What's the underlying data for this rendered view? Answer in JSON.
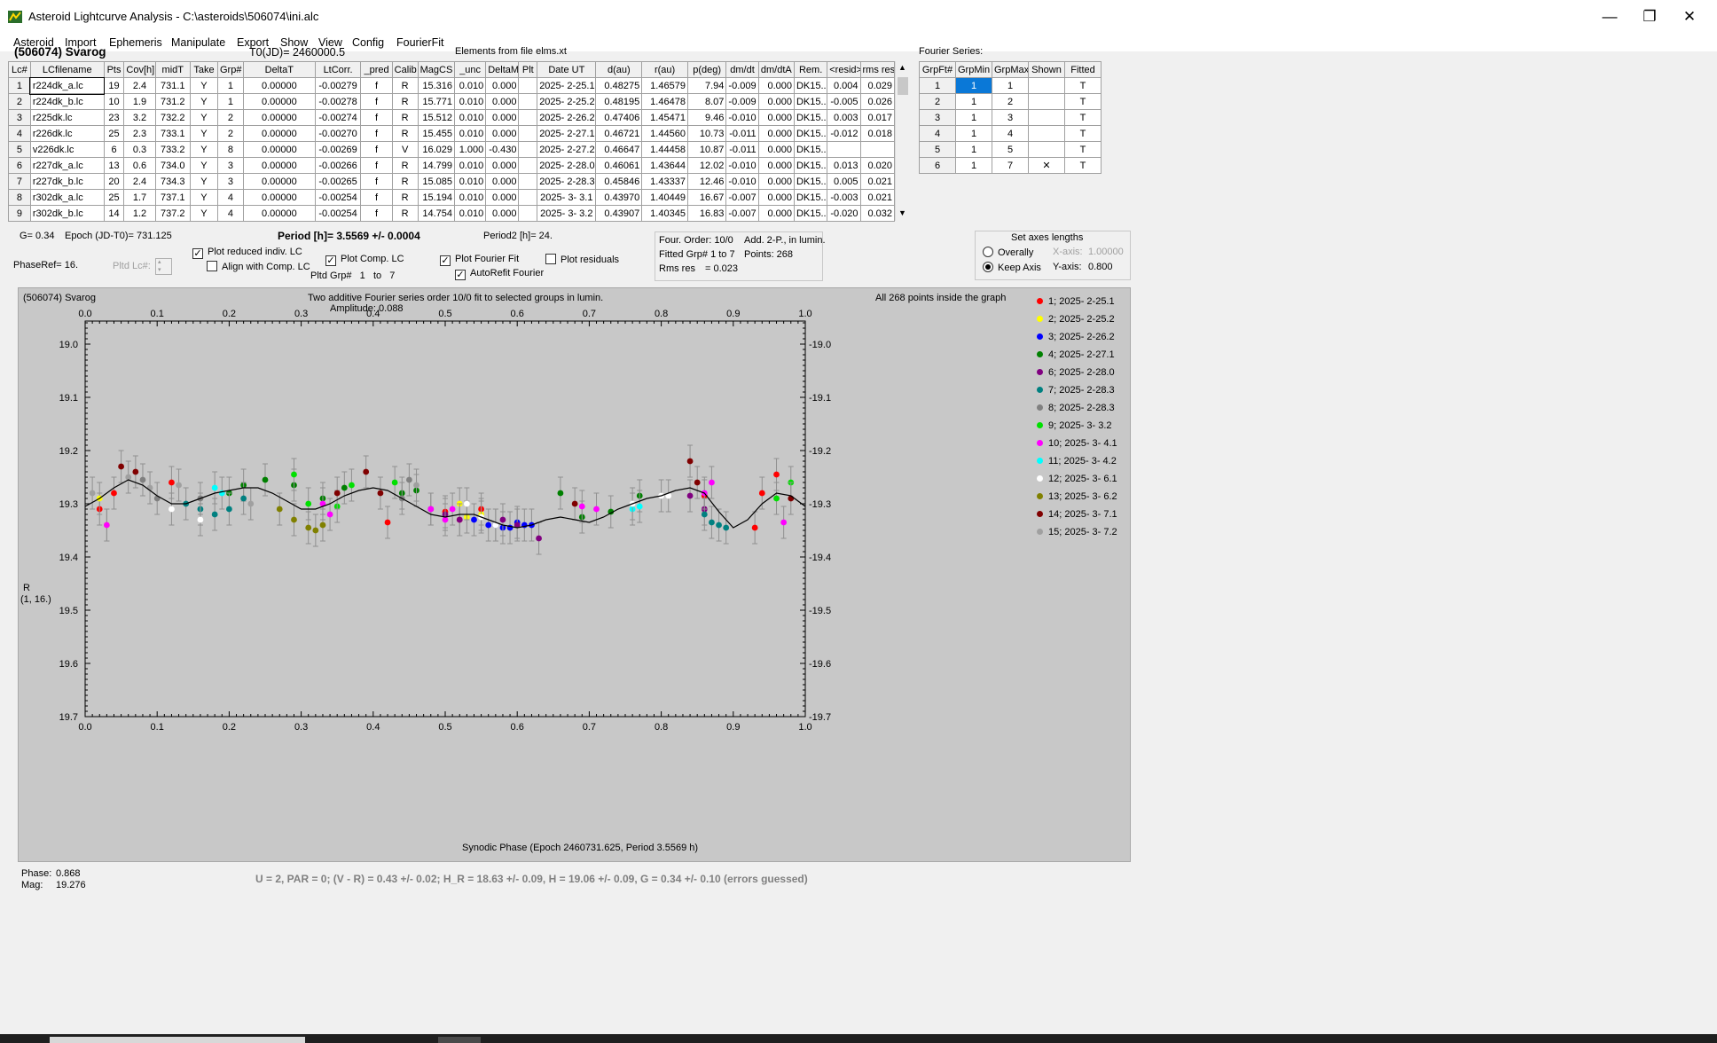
{
  "window": {
    "title": "Asteroid Lightcurve Analysis - C:\\asteroids\\506074\\ini.alc",
    "minimize": "—",
    "maximize": "❐",
    "close": "✕"
  },
  "menu": [
    "Asteroid",
    "Import",
    "Ephemeris",
    "Manipulate",
    "Export",
    "Show",
    "View",
    "Config",
    "FourierFit"
  ],
  "header": {
    "object": "(506074) Svarog",
    "t0": "T0(JD)= 2460000.5",
    "elements": "Elements from file elms.xt",
    "fourier_series": "Fourier Series:"
  },
  "lc_table": {
    "columns": [
      "Lc#",
      "LCfilename",
      "Pts",
      "Cov[h]",
      "midT",
      "Take",
      "Grp#",
      "DeltaT",
      "LtCorr.",
      "_pred",
      "Calib",
      "MagCS",
      "_unc",
      "DeltaM",
      "Plt",
      "Date UT",
      "d(au)",
      "r(au)",
      "p(deg)",
      "dm/dt",
      "dm/dtA",
      "Rem.",
      "<resid>",
      "rms res"
    ],
    "rows": [
      [
        "1",
        "r224dk_a.lc",
        "19",
        "2.4",
        "731.1",
        "Y",
        "1",
        "0.00000",
        "-0.00279",
        "f",
        "R",
        "15.316",
        "0.010",
        "0.000",
        "",
        "2025- 2-25.1",
        "0.48275",
        "1.46579",
        "7.94",
        "-0.009",
        "0.000",
        "DK15..",
        "0.004",
        "0.029"
      ],
      [
        "2",
        "r224dk_b.lc",
        "10",
        "1.9",
        "731.2",
        "Y",
        "1",
        "0.00000",
        "-0.00278",
        "f",
        "R",
        "15.771",
        "0.010",
        "0.000",
        "",
        "2025- 2-25.2",
        "0.48195",
        "1.46478",
        "8.07",
        "-0.009",
        "0.000",
        "DK15..",
        "-0.005",
        "0.026"
      ],
      [
        "3",
        "r225dk.lc",
        "23",
        "3.2",
        "732.2",
        "Y",
        "2",
        "0.00000",
        "-0.00274",
        "f",
        "R",
        "15.512",
        "0.010",
        "0.000",
        "",
        "2025- 2-26.2",
        "0.47406",
        "1.45471",
        "9.46",
        "-0.010",
        "0.000",
        "DK15..",
        "0.003",
        "0.017"
      ],
      [
        "4",
        "r226dk.lc",
        "25",
        "2.3",
        "733.1",
        "Y",
        "2",
        "0.00000",
        "-0.00270",
        "f",
        "R",
        "15.455",
        "0.010",
        "0.000",
        "",
        "2025- 2-27.1",
        "0.46721",
        "1.44560",
        "10.73",
        "-0.011",
        "0.000",
        "DK15..",
        "-0.012",
        "0.018"
      ],
      [
        "5",
        "v226dk.lc",
        "6",
        "0.3",
        "733.2",
        "Y",
        "8",
        "0.00000",
        "-0.00269",
        "f",
        "V",
        "16.029",
        "1.000",
        "-0.430",
        "",
        "2025- 2-27.2",
        "0.46647",
        "1.44458",
        "10.87",
        "-0.011",
        "0.000",
        "DK15..",
        "",
        ""
      ],
      [
        "6",
        "r227dk_a.lc",
        "13",
        "0.6",
        "734.0",
        "Y",
        "3",
        "0.00000",
        "-0.00266",
        "f",
        "R",
        "14.799",
        "0.010",
        "0.000",
        "",
        "2025- 2-28.0",
        "0.46061",
        "1.43644",
        "12.02",
        "-0.010",
        "0.000",
        "DK15..",
        "0.013",
        "0.020"
      ],
      [
        "7",
        "r227dk_b.lc",
        "20",
        "2.4",
        "734.3",
        "Y",
        "3",
        "0.00000",
        "-0.00265",
        "f",
        "R",
        "15.085",
        "0.010",
        "0.000",
        "",
        "2025- 2-28.3",
        "0.45846",
        "1.43337",
        "12.46",
        "-0.010",
        "0.000",
        "DK15..",
        "0.005",
        "0.021"
      ],
      [
        "8",
        "r302dk_a.lc",
        "25",
        "1.7",
        "737.1",
        "Y",
        "4",
        "0.00000",
        "-0.00254",
        "f",
        "R",
        "15.194",
        "0.010",
        "0.000",
        "",
        "2025- 3- 3.1",
        "0.43970",
        "1.40449",
        "16.67",
        "-0.007",
        "0.000",
        "DK15..",
        "-0.003",
        "0.021"
      ],
      [
        "9",
        "r302dk_b.lc",
        "14",
        "1.2",
        "737.2",
        "Y",
        "4",
        "0.00000",
        "-0.00254",
        "f",
        "R",
        "14.754",
        "0.010",
        "0.000",
        "",
        "2025- 3- 3.2",
        "0.43907",
        "1.40345",
        "16.83",
        "-0.007",
        "0.000",
        "DK15..",
        "-0.020",
        "0.032"
      ]
    ]
  },
  "fourier_table": {
    "columns": [
      "GrpFt#",
      "GrpMin",
      "GrpMax",
      "Shown",
      "Fitted"
    ],
    "rows": [
      [
        "1",
        "1",
        "1",
        "",
        "T"
      ],
      [
        "2",
        "1",
        "2",
        "",
        "T"
      ],
      [
        "3",
        "1",
        "3",
        "",
        "T"
      ],
      [
        "4",
        "1",
        "4",
        "",
        "T"
      ],
      [
        "5",
        "1",
        "5",
        "",
        "T"
      ],
      [
        "6",
        "1",
        "7",
        "✕",
        "T"
      ]
    ]
  },
  "controls": {
    "g": "G= 0.34",
    "epoch": "Epoch (JD-T0)= 731.125",
    "period": "Period [h]= 3.5569 +/- 0.0004",
    "period2": "Period2 [h]= 24.",
    "phase_ref": "PhaseRef= 16.",
    "pltd_lc": "Pltd Lc#:",
    "plot_reduced": "Plot reduced indiv. LC",
    "align_comp": "Align with Comp. LC",
    "plot_comp": "Plot Comp. LC",
    "pltd_grp": "Pltd Grp#",
    "pltd_grp_from": "1",
    "pltd_grp_to_label": "to",
    "pltd_grp_to": "7",
    "plot_fourier": "Plot Fourier Fit",
    "autorefit": "AutoRefit Fourier",
    "plot_residuals": "Plot residuals"
  },
  "fit_info": {
    "order": "Four. Order: 10/0",
    "add": "Add. 2-P., in lumin.",
    "fitted": "Fitted Grp# 1 to 7",
    "points": "Points: 268",
    "rms_label": "Rms res",
    "rms_value": "= 0.023"
  },
  "axes_box": {
    "title": "Set axes lengths",
    "overally": "Overally",
    "keep_axis": "Keep Axis",
    "x_axis_label": "X-axis:",
    "x_axis_value": "1.00000",
    "y_axis_label": "Y-axis:",
    "y_axis_value": "0.800"
  },
  "chart_data": {
    "type": "scatter",
    "title": "Two additive Fourier series order 10/0 fit to selected groups in lumin.",
    "subtitle": "Amplitude: 0.088",
    "object_label": "(506074) Svarog",
    "note": "All 268 points inside the graph",
    "xlabel": "Synodic Phase (Epoch 2460731.625, Period 3.5569 h)",
    "ylabel": "R",
    "ylabel2": "(1, 16.)",
    "xlim": [
      0.0,
      1.0
    ],
    "ylim": [
      19.7,
      18.9
    ],
    "x_ticks": [
      "0.0",
      "0.1",
      "0.2",
      "0.3",
      "0.4",
      "0.5",
      "0.6",
      "0.7",
      "0.8",
      "0.9",
      "1.0"
    ],
    "y_ticks": [
      "19.0",
      "19.1",
      "19.2",
      "19.3",
      "19.4",
      "19.5",
      "19.6",
      "19.7"
    ],
    "fit_curve": {
      "x": [
        0.0,
        0.02,
        0.04,
        0.06,
        0.08,
        0.1,
        0.12,
        0.14,
        0.16,
        0.18,
        0.2,
        0.22,
        0.24,
        0.26,
        0.28,
        0.3,
        0.32,
        0.34,
        0.36,
        0.38,
        0.4,
        0.42,
        0.44,
        0.46,
        0.48,
        0.5,
        0.52,
        0.54,
        0.56,
        0.58,
        0.6,
        0.62,
        0.64,
        0.66,
        0.68,
        0.7,
        0.72,
        0.74,
        0.76,
        0.78,
        0.8,
        0.82,
        0.84,
        0.86,
        0.88,
        0.9,
        0.92,
        0.94,
        0.96,
        0.98,
        1.0
      ],
      "y": [
        19.305,
        19.29,
        19.27,
        19.255,
        19.265,
        19.285,
        19.3,
        19.3,
        19.29,
        19.28,
        19.275,
        19.27,
        19.27,
        19.28,
        19.295,
        19.31,
        19.31,
        19.3,
        19.285,
        19.275,
        19.27,
        19.275,
        19.29,
        19.305,
        19.32,
        19.325,
        19.32,
        19.32,
        19.33,
        19.34,
        19.345,
        19.34,
        19.33,
        19.325,
        19.33,
        19.335,
        19.325,
        19.31,
        19.3,
        19.29,
        19.285,
        19.275,
        19.27,
        19.28,
        19.315,
        19.345,
        19.33,
        19.3,
        19.28,
        19.285,
        19.305
      ]
    },
    "series": [
      {
        "name": "1; 2025- 2-25.1",
        "color": "#ff0000",
        "x": [
          0.02,
          0.04,
          0.12,
          0.42,
          0.5,
          0.52,
          0.55,
          0.86,
          0.93,
          0.94,
          0.96
        ],
        "y": [
          19.31,
          19.28,
          19.26,
          19.335,
          19.315,
          19.33,
          19.31,
          19.285,
          19.345,
          19.28,
          19.245
        ]
      },
      {
        "name": "2; 2025- 2-25.2",
        "color": "#ffff00",
        "x": [
          0.02,
          0.03,
          0.52,
          0.53,
          0.55
        ],
        "y": [
          19.29,
          19.34,
          19.3,
          19.325,
          19.32
        ]
      },
      {
        "name": "3; 2025- 2-26.2",
        "color": "#0000ff",
        "x": [
          0.54,
          0.56,
          0.57,
          0.58,
          0.59,
          0.6,
          0.61,
          0.62
        ],
        "y": [
          19.33,
          19.34,
          19.34,
          19.345,
          19.345,
          19.335,
          19.34,
          19.34
        ]
      },
      {
        "name": "4; 2025- 2-27.1",
        "color": "#008000",
        "x": [
          0.2,
          0.22,
          0.25,
          0.29,
          0.33,
          0.36,
          0.44,
          0.46,
          0.66,
          0.69,
          0.73,
          0.77
        ],
        "y": [
          19.28,
          19.265,
          19.255,
          19.265,
          19.29,
          19.27,
          19.28,
          19.275,
          19.28,
          19.325,
          19.315,
          19.285
        ]
      },
      {
        "name": "6; 2025- 2-28.0",
        "color": "#800080",
        "x": [
          0.48,
          0.5,
          0.52,
          0.58,
          0.6,
          0.63,
          0.84,
          0.86
        ],
        "y": [
          19.31,
          19.32,
          19.33,
          19.33,
          19.34,
          19.365,
          19.285,
          19.31
        ]
      },
      {
        "name": "7; 2025- 2-28.3",
        "color": "#008080",
        "x": [
          0.14,
          0.16,
          0.18,
          0.2,
          0.22,
          0.86,
          0.87,
          0.88,
          0.89
        ],
        "y": [
          19.3,
          19.31,
          19.32,
          19.31,
          19.29,
          19.32,
          19.335,
          19.34,
          19.345
        ]
      },
      {
        "name": "8; 2025- 2-28.3",
        "color": "#808080",
        "x": [
          0.08,
          0.1,
          0.16,
          0.44,
          0.45
        ],
        "y": [
          19.255,
          19.29,
          19.29,
          19.29,
          19.255
        ]
      },
      {
        "name": "9; 2025- 3- 3.2",
        "color": "#00e000",
        "x": [
          0.29,
          0.31,
          0.35,
          0.37,
          0.43,
          0.96,
          0.98
        ],
        "y": [
          19.245,
          19.3,
          19.305,
          19.265,
          19.26,
          19.29,
          19.26
        ]
      },
      {
        "name": "10; 2025- 3- 4.1",
        "color": "#ff00ff",
        "x": [
          0.03,
          0.33,
          0.34,
          0.48,
          0.5,
          0.51,
          0.69,
          0.71,
          0.86,
          0.87,
          0.97
        ],
        "y": [
          19.34,
          19.3,
          19.32,
          19.31,
          19.33,
          19.31,
          19.305,
          19.31,
          19.28,
          19.26,
          19.335
        ]
      },
      {
        "name": "11; 2025- 3- 4.2",
        "color": "#00ffff",
        "x": [
          0.18,
          0.19,
          0.76,
          0.77
        ],
        "y": [
          19.27,
          19.28,
          19.31,
          19.305
        ]
      },
      {
        "name": "12; 2025- 3- 6.1",
        "color": "#ffffff",
        "x": [
          0.12,
          0.16,
          0.53,
          0.55,
          0.57,
          0.76,
          0.8,
          0.81
        ],
        "y": [
          19.31,
          19.33,
          19.3,
          19.325,
          19.34,
          19.3,
          19.285,
          19.285
        ]
      },
      {
        "name": "13; 2025- 3- 6.2",
        "color": "#808000",
        "x": [
          0.27,
          0.29,
          0.31,
          0.32,
          0.33
        ],
        "y": [
          19.31,
          19.33,
          19.345,
          19.35,
          19.34
        ]
      },
      {
        "name": "14; 2025- 3- 7.1",
        "color": "#800000",
        "x": [
          0.05,
          0.07,
          0.35,
          0.39,
          0.41,
          0.68,
          0.84,
          0.85,
          0.98
        ],
        "y": [
          19.23,
          19.24,
          19.28,
          19.24,
          19.28,
          19.3,
          19.22,
          19.26,
          19.29
        ]
      },
      {
        "name": "15; 2025- 3- 7.2",
        "color": "#a0a0a0",
        "x": [
          0.01,
          0.06,
          0.09,
          0.13,
          0.23,
          0.46
        ],
        "y": [
          19.28,
          19.25,
          19.27,
          19.265,
          19.3,
          19.265
        ]
      }
    ]
  },
  "status": {
    "phase_label": "Phase:",
    "phase_value": "0.868",
    "mag_label": "Mag:",
    "mag_value": "19.276",
    "result": "U = 2, PAR = 0; (V - R) = 0.43 +/- 0.02; H_R = 18.63 +/- 0.09, H = 19.06 +/- 0.09, G = 0.34 +/- 0.10 (errors guessed)"
  }
}
